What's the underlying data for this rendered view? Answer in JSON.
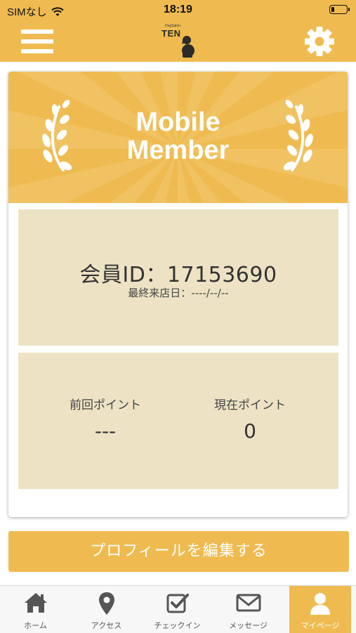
{
  "status_bar": {
    "carrier": "SIMなし",
    "time": "18:19",
    "battery_level": 0.2
  },
  "header": {
    "logo_small": "DogSalon",
    "logo_text": "TEN"
  },
  "card": {
    "banner_title": "Mobile\nMember",
    "member_id": "会員ID：17153690",
    "last_visit": "最終来店日：----/--/--",
    "points": {
      "previous_label": "前回ポイント",
      "previous_value": "---",
      "current_label": "現在ポイント",
      "current_value": "0"
    }
  },
  "edit_profile_label": "プロフィールを編集する",
  "tabs": [
    {
      "label": "ホーム",
      "icon": "home-icon",
      "active": false
    },
    {
      "label": "アクセス",
      "icon": "map-pin-icon",
      "active": false
    },
    {
      "label": "チェックイン",
      "icon": "checkin-icon",
      "active": false
    },
    {
      "label": "メッセージ",
      "icon": "envelope-icon",
      "active": false
    },
    {
      "label": "マイページ",
      "icon": "user-icon",
      "active": true
    }
  ],
  "colors": {
    "accent": "#efbb50",
    "panel": "#ede3c4",
    "white": "#ffffff"
  }
}
